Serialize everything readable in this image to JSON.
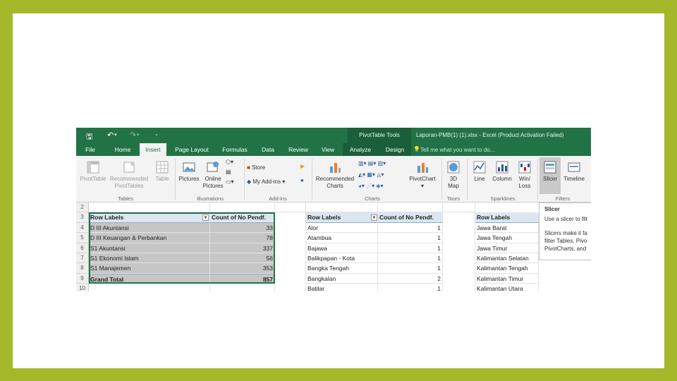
{
  "title_bar": {
    "context_tab": "PivotTable Tools",
    "document_title": "Laporan-PMB(1) (1).xlsx - Excel (Product Activation Failed)"
  },
  "tabs": [
    {
      "label": "File"
    },
    {
      "label": "Home"
    },
    {
      "label": "Insert"
    },
    {
      "label": "Page Layout"
    },
    {
      "label": "Formulas"
    },
    {
      "label": "Data"
    },
    {
      "label": "Review"
    },
    {
      "label": "View"
    },
    {
      "label": "Analyze"
    },
    {
      "label": "Design"
    }
  ],
  "tell_me": "Tell me what you want to do...",
  "ribbon": {
    "tables": {
      "pivottable": "PivotTable",
      "recommended": "Recommended",
      "recommended2": "PivotTables",
      "table": "Table",
      "group": "Tables"
    },
    "illustrations": {
      "pictures": "Pictures",
      "online": "Online",
      "online2": "Pictures",
      "group": "Illustrations"
    },
    "addins": {
      "store": "Store",
      "my_addins": "My Add-ins",
      "group": "Add-ins"
    },
    "charts": {
      "recommended": "Recommended",
      "recommended2": "Charts",
      "pivotchart": "PivotChart",
      "group": "Charts"
    },
    "tours": {
      "map": "3D",
      "map2": "Map",
      "group": "Tours"
    },
    "sparklines": {
      "line": "Line",
      "column": "Column",
      "winloss": "Win/",
      "winloss2": "Loss",
      "group": "Sparklines"
    },
    "filters": {
      "slicer": "Slicer",
      "timeline": "Timeline",
      "group": "Filters"
    }
  },
  "rows": [
    "2",
    "3",
    "4",
    "5",
    "6",
    "7",
    "8",
    "9",
    "10"
  ],
  "pivot1": {
    "header_label": "Row Labels",
    "header_count": "Count of No Pendf.",
    "items": [
      {
        "label": "D III Akuntansi",
        "count": "33"
      },
      {
        "label": "D III Keuangan & Perbankan",
        "count": "78"
      },
      {
        "label": "S1 Akuntansi",
        "count": "337"
      },
      {
        "label": "S1 Ekonomi Islam",
        "count": "56"
      },
      {
        "label": "S1 Manajemen",
        "count": "353"
      }
    ],
    "grand_label": "Grand Total",
    "grand_count": "857"
  },
  "pivot2": {
    "header_label": "Row Labels",
    "header_count": "Count of No Pendf.",
    "items": [
      {
        "label": "Alor",
        "count": "1"
      },
      {
        "label": "Atambua",
        "count": "1"
      },
      {
        "label": "Bajawa",
        "count": "1"
      },
      {
        "label": "Balikpapan - Kota",
        "count": "1"
      },
      {
        "label": "Bangka Tengah",
        "count": "1"
      },
      {
        "label": "Bangkalan",
        "count": "2"
      },
      {
        "label": "Batilar",
        "count": "1"
      }
    ]
  },
  "pivot3": {
    "header_label": "Row Labels",
    "items": [
      {
        "label": "Jawa Barat"
      },
      {
        "label": "Jawa Tengah"
      },
      {
        "label": "Jawa Timur"
      },
      {
        "label": "Kalimantan Selatan"
      },
      {
        "label": "Kalimantan Tengah"
      },
      {
        "label": "Kalimantan Timur"
      },
      {
        "label": "Kalimantan Utara"
      }
    ]
  },
  "tooltip": {
    "title": "Slicer",
    "line1": "Use a slicer to filt",
    "line2": "Slicers make it fa",
    "line3": "filter Tables, Pivo",
    "line4": "PivotCharts, and"
  },
  "colors": {
    "accent": "#217346",
    "frame": "#a4b82a",
    "pivot_header": "#dce6f1",
    "selection": "#c6c6c6"
  }
}
